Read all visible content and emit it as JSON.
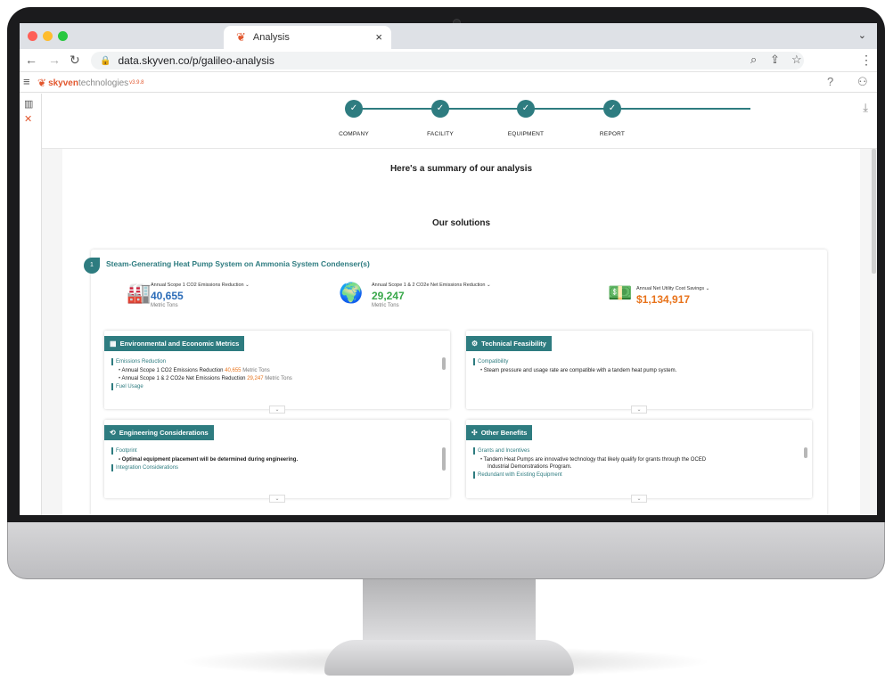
{
  "browser": {
    "tab_title": "Analysis",
    "tab_close": "×",
    "url": "data.skyven.co/p/galileo-analysis"
  },
  "app": {
    "brand_name": "skyven",
    "brand_suffix": "technologies",
    "version": "v3.9.8"
  },
  "stepper": {
    "steps": [
      {
        "label": "COMPANY"
      },
      {
        "label": "FACILITY"
      },
      {
        "label": "EQUIPMENT"
      },
      {
        "label": "REPORT"
      }
    ]
  },
  "content": {
    "summary_title": "Here's a summary of our analysis",
    "solutions_title": "Our solutions",
    "solution": {
      "number": "1",
      "title": "Steam-Generating Heat Pump System on Ammonia System Condenser(s)",
      "metrics": [
        {
          "label": "Annual Scope 1 CO2 Emissions Reduction",
          "value": "40,655",
          "unit": "Metric Tons",
          "color": "#2b6cb8"
        },
        {
          "label": "Annual Scope 1 & 2 CO2e Net Emissions Reduction",
          "value": "29,247",
          "unit": "Metric Tons",
          "color": "#3aa84b"
        },
        {
          "label": "Annual Net Utility Cost Savings",
          "value": "$1,134,917",
          "unit": "",
          "color": "#e8731b"
        }
      ],
      "boxes": {
        "env": {
          "title": "Environmental and Economic Metrics",
          "section1": "Emissions Reduction",
          "item1_text": "Annual Scope 1 CO2 Emissions Reduction",
          "item1_value": "40,655",
          "item1_unit": "Metric Tons",
          "item2_text": "Annual Scope 1 & 2 CO2e Net Emissions Reduction",
          "item2_value": "29,247",
          "item2_unit": "Metric Tons",
          "section2": "Fuel Usage"
        },
        "tech": {
          "title": "Technical Feasibility",
          "section1": "Compatibility",
          "item1": "Steam pressure and usage rate are compatible with a tandem heat pump system."
        },
        "eng": {
          "title": "Engineering Considerations",
          "section1": "Footprint",
          "item1": "Optimal equipment placement will be determined during engineering.",
          "section2": "Integration Considerations"
        },
        "other": {
          "title": "Other Benefits",
          "section1": "Grants and Incentives",
          "item1_line1": "Tandem Heat Pumps are innovative technology that likely qualify for grants through the OCED",
          "item1_line2": "Industrial Demonstrations Program.",
          "section2": "Redundant with Existing Equipment"
        }
      }
    }
  },
  "icons": {
    "back": "back-arrow-icon",
    "forward": "forward-arrow-icon",
    "reload": "reload-icon",
    "lock": "lock-icon",
    "zoom": "zoom-icon",
    "share": "share-icon",
    "star": "bookmark-star-icon",
    "menu": "kebab-menu-icon",
    "help": "help-icon",
    "user": "user-icon",
    "download": "download-icon"
  },
  "colors": {
    "accent": "#2e7c80",
    "brand": "#e2572e",
    "highlight": "#e8731b"
  }
}
